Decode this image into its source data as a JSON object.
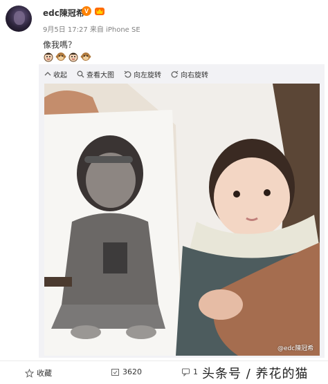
{
  "user": {
    "name": "edc陳冠希",
    "verified_badge": "V",
    "meta": "9月5日 17:27 来自 iPhone SE"
  },
  "post": {
    "text": "像我嗎？",
    "emojis": [
      "cartoon-face-icon",
      "monkey-icon",
      "cartoon-face-icon",
      "monkey-icon"
    ]
  },
  "toolbar": {
    "collapse": "收起",
    "view_large": "查看大图",
    "rotate_left": "向左旋转",
    "rotate_right": "向右旋转"
  },
  "photo": {
    "watermark": "@edc陳冠希"
  },
  "footer": {
    "favorite": "收藏",
    "repost_count": "3620",
    "comment_count": "1"
  },
  "overlay": {
    "watermark": "头条号 / 养花的猫"
  },
  "colors": {
    "accent": "#ff8200",
    "text": "#333333",
    "meta": "#808080",
    "panel": "#f2f2f5"
  }
}
